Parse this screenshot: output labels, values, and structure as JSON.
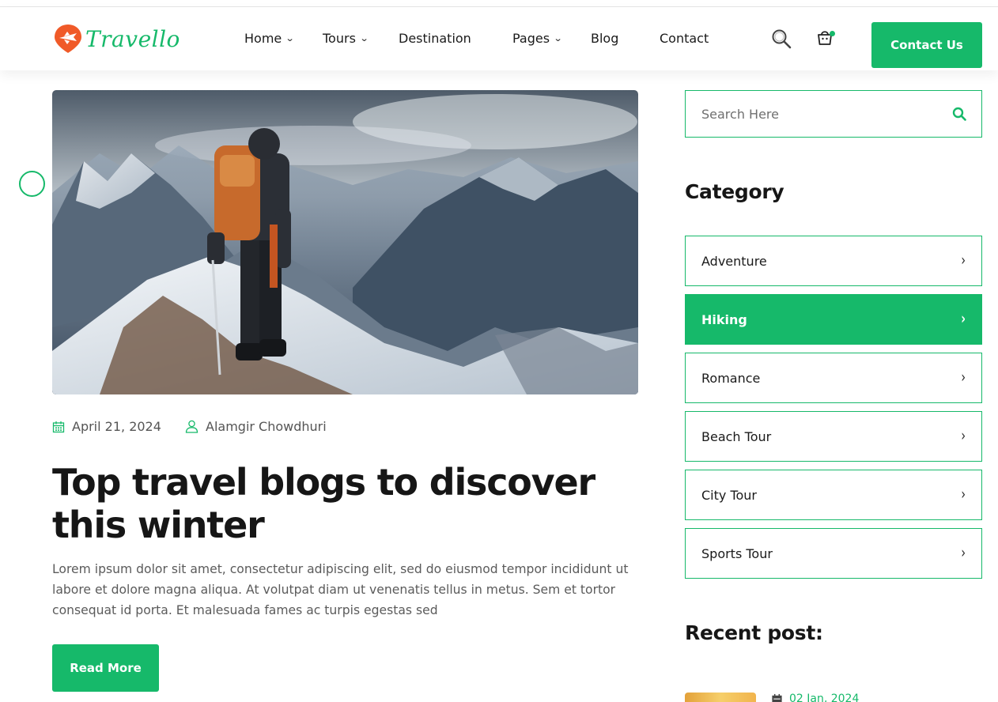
{
  "brand": {
    "name": "Travello",
    "color": "#16b96a",
    "icon": "plane-location-logo-icon"
  },
  "nav": {
    "items": [
      {
        "label": "Home",
        "dropdown": true
      },
      {
        "label": "Tours",
        "dropdown": true
      },
      {
        "label": "Destination",
        "dropdown": false
      },
      {
        "label": "Pages",
        "dropdown": true
      },
      {
        "label": "Blog",
        "dropdown": false
      },
      {
        "label": "Contact",
        "dropdown": false
      }
    ],
    "search_icon": "search-icon",
    "cart_icon": "shopping-basket-icon",
    "cta_label": "Contact Us"
  },
  "post": {
    "image_alt": "Hiker with backpack standing on a snowy mountain ridge",
    "date": "April 21, 2024",
    "author": "Alamgir Chowdhuri",
    "title": "Top travel blogs to discover this winter",
    "excerpt": "Lorem ipsum dolor sit amet, consectetur adipiscing elit, sed do eiusmod tempor incididunt ut labore et dolore magna aliqua. At volutpat diam ut venenatis tellus in metus. Sem et tortor consequat id porta. Et malesuada fames ac turpis egestas sed",
    "read_more_label": "Read More"
  },
  "sidebar": {
    "search_placeholder": "Search Here",
    "category_heading": "Category",
    "categories": [
      {
        "label": "Adventure",
        "active": false
      },
      {
        "label": "Hiking",
        "active": true
      },
      {
        "label": "Romance",
        "active": false
      },
      {
        "label": "Beach Tour",
        "active": false
      },
      {
        "label": "City Tour",
        "active": false
      },
      {
        "label": "Sports Tour",
        "active": false
      }
    ],
    "recent_heading": "Recent post:",
    "recent_posts": [
      {
        "date": "02 Jan, 2024"
      }
    ]
  },
  "colors": {
    "accent": "#16b96a",
    "logo_orange": "#f05a28",
    "text_dark": "#161616",
    "text_muted": "#5b5b5b"
  }
}
